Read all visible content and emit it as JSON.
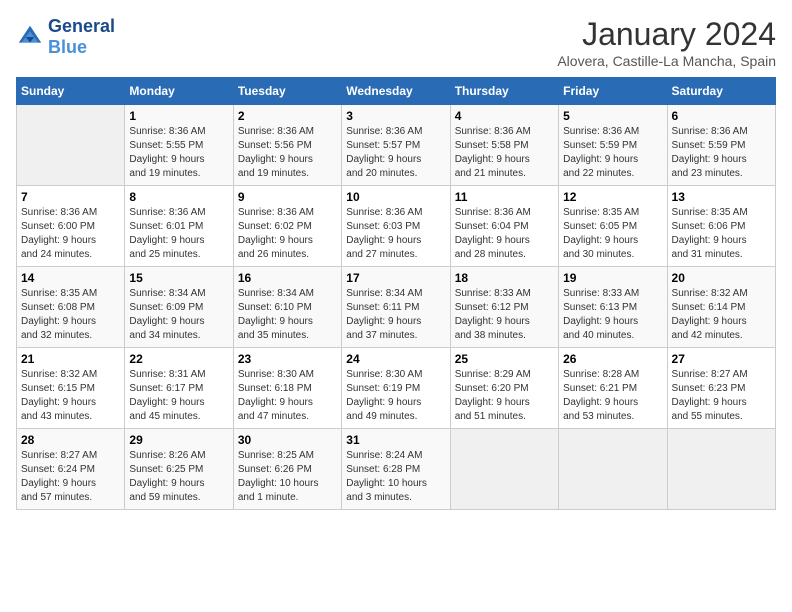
{
  "header": {
    "logo_line1": "General",
    "logo_line2": "Blue",
    "title": "January 2024",
    "subtitle": "Alovera, Castille-La Mancha, Spain"
  },
  "days_of_week": [
    "Sunday",
    "Monday",
    "Tuesday",
    "Wednesday",
    "Thursday",
    "Friday",
    "Saturday"
  ],
  "weeks": [
    [
      {
        "day": "",
        "info": ""
      },
      {
        "day": "1",
        "info": "Sunrise: 8:36 AM\nSunset: 5:55 PM\nDaylight: 9 hours\nand 19 minutes."
      },
      {
        "day": "2",
        "info": "Sunrise: 8:36 AM\nSunset: 5:56 PM\nDaylight: 9 hours\nand 19 minutes."
      },
      {
        "day": "3",
        "info": "Sunrise: 8:36 AM\nSunset: 5:57 PM\nDaylight: 9 hours\nand 20 minutes."
      },
      {
        "day": "4",
        "info": "Sunrise: 8:36 AM\nSunset: 5:58 PM\nDaylight: 9 hours\nand 21 minutes."
      },
      {
        "day": "5",
        "info": "Sunrise: 8:36 AM\nSunset: 5:59 PM\nDaylight: 9 hours\nand 22 minutes."
      },
      {
        "day": "6",
        "info": "Sunrise: 8:36 AM\nSunset: 5:59 PM\nDaylight: 9 hours\nand 23 minutes."
      }
    ],
    [
      {
        "day": "7",
        "info": "Sunrise: 8:36 AM\nSunset: 6:00 PM\nDaylight: 9 hours\nand 24 minutes."
      },
      {
        "day": "8",
        "info": "Sunrise: 8:36 AM\nSunset: 6:01 PM\nDaylight: 9 hours\nand 25 minutes."
      },
      {
        "day": "9",
        "info": "Sunrise: 8:36 AM\nSunset: 6:02 PM\nDaylight: 9 hours\nand 26 minutes."
      },
      {
        "day": "10",
        "info": "Sunrise: 8:36 AM\nSunset: 6:03 PM\nDaylight: 9 hours\nand 27 minutes."
      },
      {
        "day": "11",
        "info": "Sunrise: 8:36 AM\nSunset: 6:04 PM\nDaylight: 9 hours\nand 28 minutes."
      },
      {
        "day": "12",
        "info": "Sunrise: 8:35 AM\nSunset: 6:05 PM\nDaylight: 9 hours\nand 30 minutes."
      },
      {
        "day": "13",
        "info": "Sunrise: 8:35 AM\nSunset: 6:06 PM\nDaylight: 9 hours\nand 31 minutes."
      }
    ],
    [
      {
        "day": "14",
        "info": "Sunrise: 8:35 AM\nSunset: 6:08 PM\nDaylight: 9 hours\nand 32 minutes."
      },
      {
        "day": "15",
        "info": "Sunrise: 8:34 AM\nSunset: 6:09 PM\nDaylight: 9 hours\nand 34 minutes."
      },
      {
        "day": "16",
        "info": "Sunrise: 8:34 AM\nSunset: 6:10 PM\nDaylight: 9 hours\nand 35 minutes."
      },
      {
        "day": "17",
        "info": "Sunrise: 8:34 AM\nSunset: 6:11 PM\nDaylight: 9 hours\nand 37 minutes."
      },
      {
        "day": "18",
        "info": "Sunrise: 8:33 AM\nSunset: 6:12 PM\nDaylight: 9 hours\nand 38 minutes."
      },
      {
        "day": "19",
        "info": "Sunrise: 8:33 AM\nSunset: 6:13 PM\nDaylight: 9 hours\nand 40 minutes."
      },
      {
        "day": "20",
        "info": "Sunrise: 8:32 AM\nSunset: 6:14 PM\nDaylight: 9 hours\nand 42 minutes."
      }
    ],
    [
      {
        "day": "21",
        "info": "Sunrise: 8:32 AM\nSunset: 6:15 PM\nDaylight: 9 hours\nand 43 minutes."
      },
      {
        "day": "22",
        "info": "Sunrise: 8:31 AM\nSunset: 6:17 PM\nDaylight: 9 hours\nand 45 minutes."
      },
      {
        "day": "23",
        "info": "Sunrise: 8:30 AM\nSunset: 6:18 PM\nDaylight: 9 hours\nand 47 minutes."
      },
      {
        "day": "24",
        "info": "Sunrise: 8:30 AM\nSunset: 6:19 PM\nDaylight: 9 hours\nand 49 minutes."
      },
      {
        "day": "25",
        "info": "Sunrise: 8:29 AM\nSunset: 6:20 PM\nDaylight: 9 hours\nand 51 minutes."
      },
      {
        "day": "26",
        "info": "Sunrise: 8:28 AM\nSunset: 6:21 PM\nDaylight: 9 hours\nand 53 minutes."
      },
      {
        "day": "27",
        "info": "Sunrise: 8:27 AM\nSunset: 6:23 PM\nDaylight: 9 hours\nand 55 minutes."
      }
    ],
    [
      {
        "day": "28",
        "info": "Sunrise: 8:27 AM\nSunset: 6:24 PM\nDaylight: 9 hours\nand 57 minutes."
      },
      {
        "day": "29",
        "info": "Sunrise: 8:26 AM\nSunset: 6:25 PM\nDaylight: 9 hours\nand 59 minutes."
      },
      {
        "day": "30",
        "info": "Sunrise: 8:25 AM\nSunset: 6:26 PM\nDaylight: 10 hours\nand 1 minute."
      },
      {
        "day": "31",
        "info": "Sunrise: 8:24 AM\nSunset: 6:28 PM\nDaylight: 10 hours\nand 3 minutes."
      },
      {
        "day": "",
        "info": ""
      },
      {
        "day": "",
        "info": ""
      },
      {
        "day": "",
        "info": ""
      }
    ]
  ]
}
